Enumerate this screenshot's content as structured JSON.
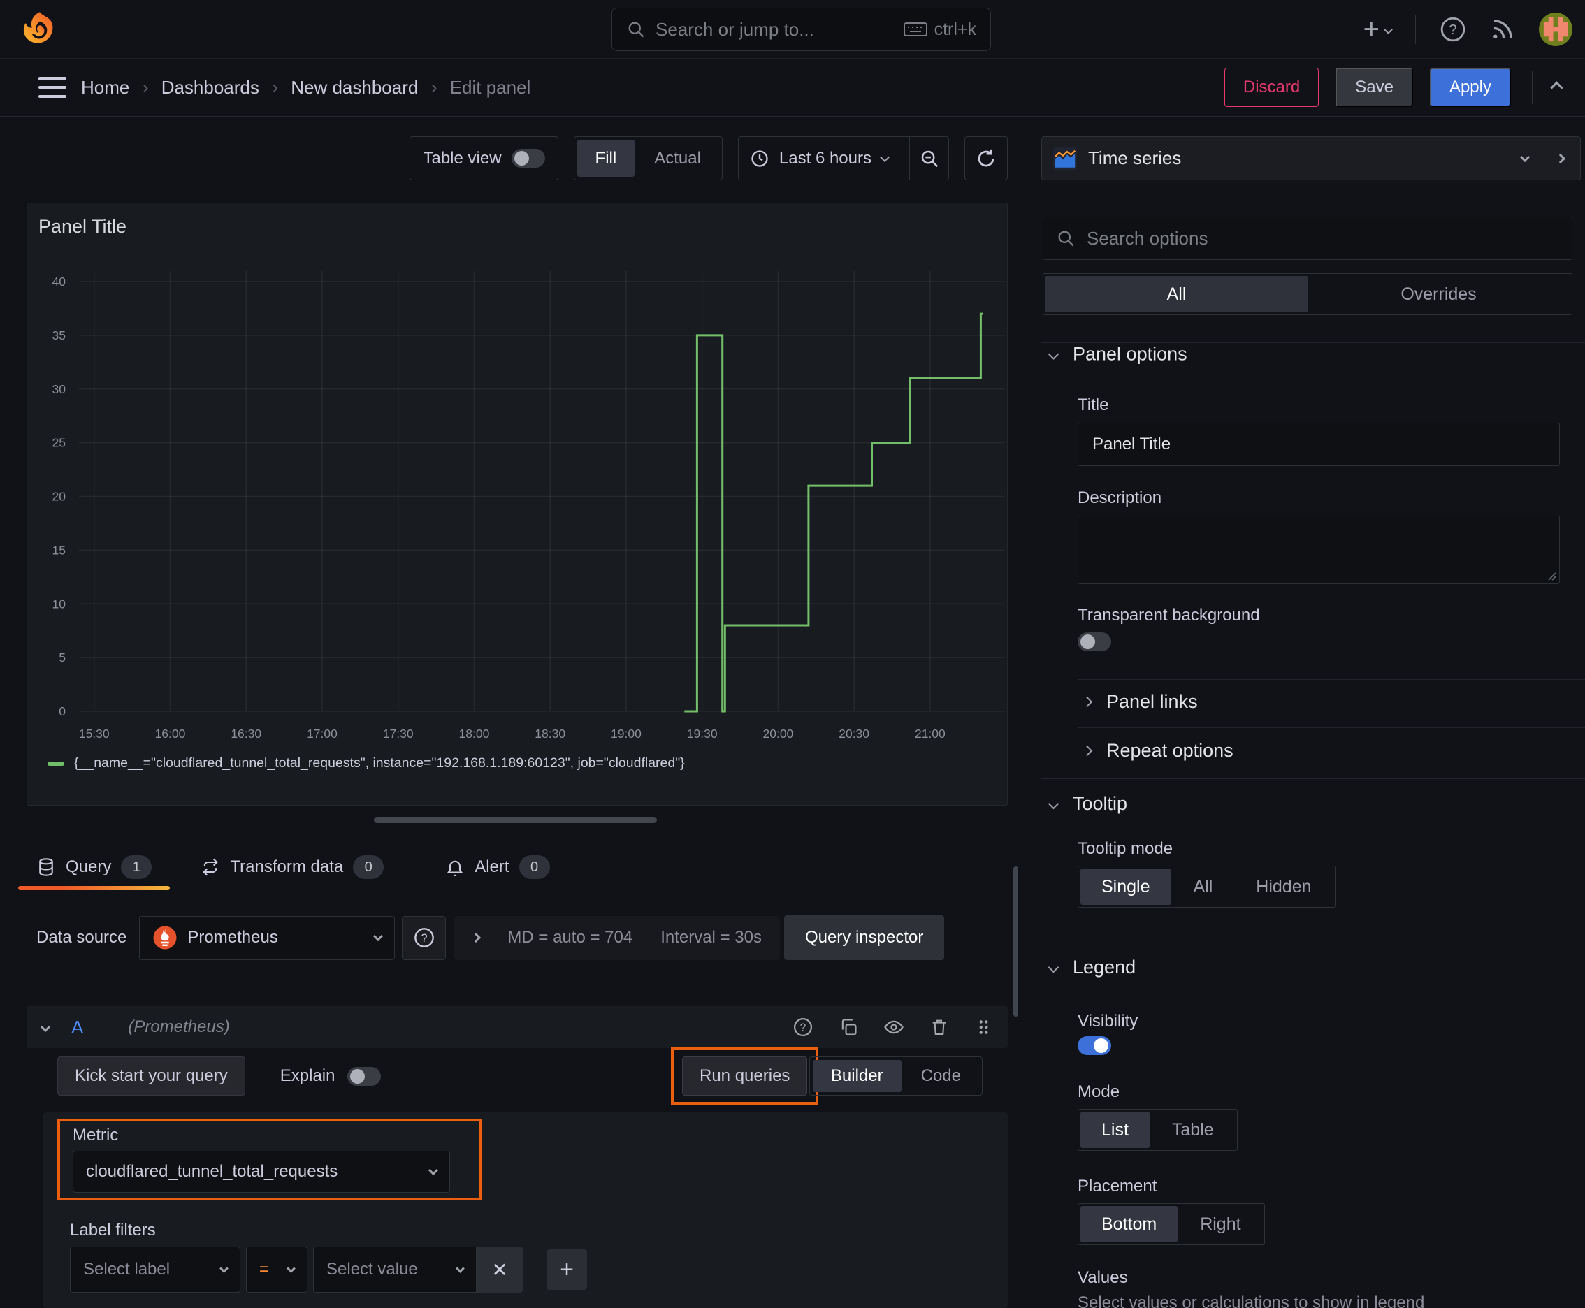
{
  "colors": {
    "background": "#111217",
    "panel": "#181b1f",
    "accent_orange": "#ff8833",
    "highlight_orange": "#ed5f0e",
    "series_green": "#73bf69",
    "primary_blue": "#3d71d9",
    "discard_pink": "#e8396f",
    "ref_id_blue": "#4d8bf8"
  },
  "topnav": {
    "search_placeholder": "Search or jump to...",
    "search_shortcut": "ctrl+k"
  },
  "breadcrumb": {
    "home": "Home",
    "dashboards": "Dashboards",
    "dashboard_name": "New dashboard",
    "current": "Edit panel"
  },
  "header_actions": {
    "discard": "Discard",
    "save": "Save",
    "apply": "Apply"
  },
  "toolbar": {
    "table_view": "Table view",
    "fill": "Fill",
    "actual": "Actual",
    "time_range": "Last 6 hours"
  },
  "viz_picker": {
    "label": "Time series"
  },
  "panel": {
    "title": "Panel Title"
  },
  "chart_data": {
    "type": "line",
    "render": "stepped",
    "title": "Panel Title",
    "xlabel": "",
    "ylabel": "",
    "grid": true,
    "legend_position": "bottom",
    "x_range": [
      "15:24",
      "21:29"
    ],
    "y_range": [
      0,
      41.5
    ],
    "y_ticks": [
      0,
      5,
      10,
      15,
      20,
      25,
      30,
      35,
      40
    ],
    "x_ticks": [
      "15:30",
      "16:00",
      "16:30",
      "17:00",
      "17:30",
      "18:00",
      "18:30",
      "19:00",
      "19:30",
      "20:00",
      "20:30",
      "21:00"
    ],
    "series": [
      {
        "name": "{__name__=\"cloudflared_tunnel_total_requests\", instance=\"192.168.1.189:60123\", job=\"cloudflared\"}",
        "color": "#73bf69",
        "points": [
          [
            "19:23",
            0
          ],
          [
            "19:28",
            35
          ],
          [
            "19:38",
            0
          ],
          [
            "19:39",
            8
          ],
          [
            "20:12",
            21
          ],
          [
            "20:37",
            25
          ],
          [
            "20:52",
            31
          ],
          [
            "21:20",
            37
          ]
        ],
        "end_time": "21:21"
      }
    ]
  },
  "tabs": {
    "query": "Query",
    "query_count": "1",
    "transform": "Transform data",
    "transform_count": "0",
    "alert": "Alert",
    "alert_count": "0"
  },
  "datasource_row": {
    "label": "Data source",
    "value": "Prometheus",
    "max_data_points": "MD = auto = 704",
    "interval": "Interval = 30s",
    "query_inspector": "Query inspector"
  },
  "query_row": {
    "ref_id": "A",
    "datasource_hint": "(Prometheus)"
  },
  "query_actions": {
    "kick_start": "Kick start your query",
    "explain": "Explain",
    "run_queries": "Run queries",
    "builder": "Builder",
    "code": "Code"
  },
  "builder": {
    "metric_label": "Metric",
    "metric_value": "cloudflared_tunnel_total_requests",
    "label_filters_label": "Label filters",
    "select_label": "Select label",
    "operator": "=",
    "select_value": "Select value"
  },
  "options_pane": {
    "search_placeholder": "Search options",
    "tab_all": "All",
    "tab_overrides": "Overrides",
    "panel_options": {
      "header": "Panel options",
      "title_label": "Title",
      "title_value": "Panel Title",
      "description_label": "Description",
      "transparent_bg": "Transparent background"
    },
    "collapsed": {
      "panel_links": "Panel links",
      "repeat_options": "Repeat options"
    },
    "tooltip": {
      "header": "Tooltip",
      "mode_label": "Tooltip mode",
      "options": [
        "Single",
        "All",
        "Hidden"
      ],
      "selected": "Single"
    },
    "legend": {
      "header": "Legend",
      "visibility_label": "Visibility",
      "mode_label": "Mode",
      "mode_options": [
        "List",
        "Table"
      ],
      "mode_selected": "List",
      "placement_label": "Placement",
      "placement_options": [
        "Bottom",
        "Right"
      ],
      "placement_selected": "Bottom",
      "values_label": "Values",
      "values_help": "Select values or calculations to show in legend"
    }
  }
}
